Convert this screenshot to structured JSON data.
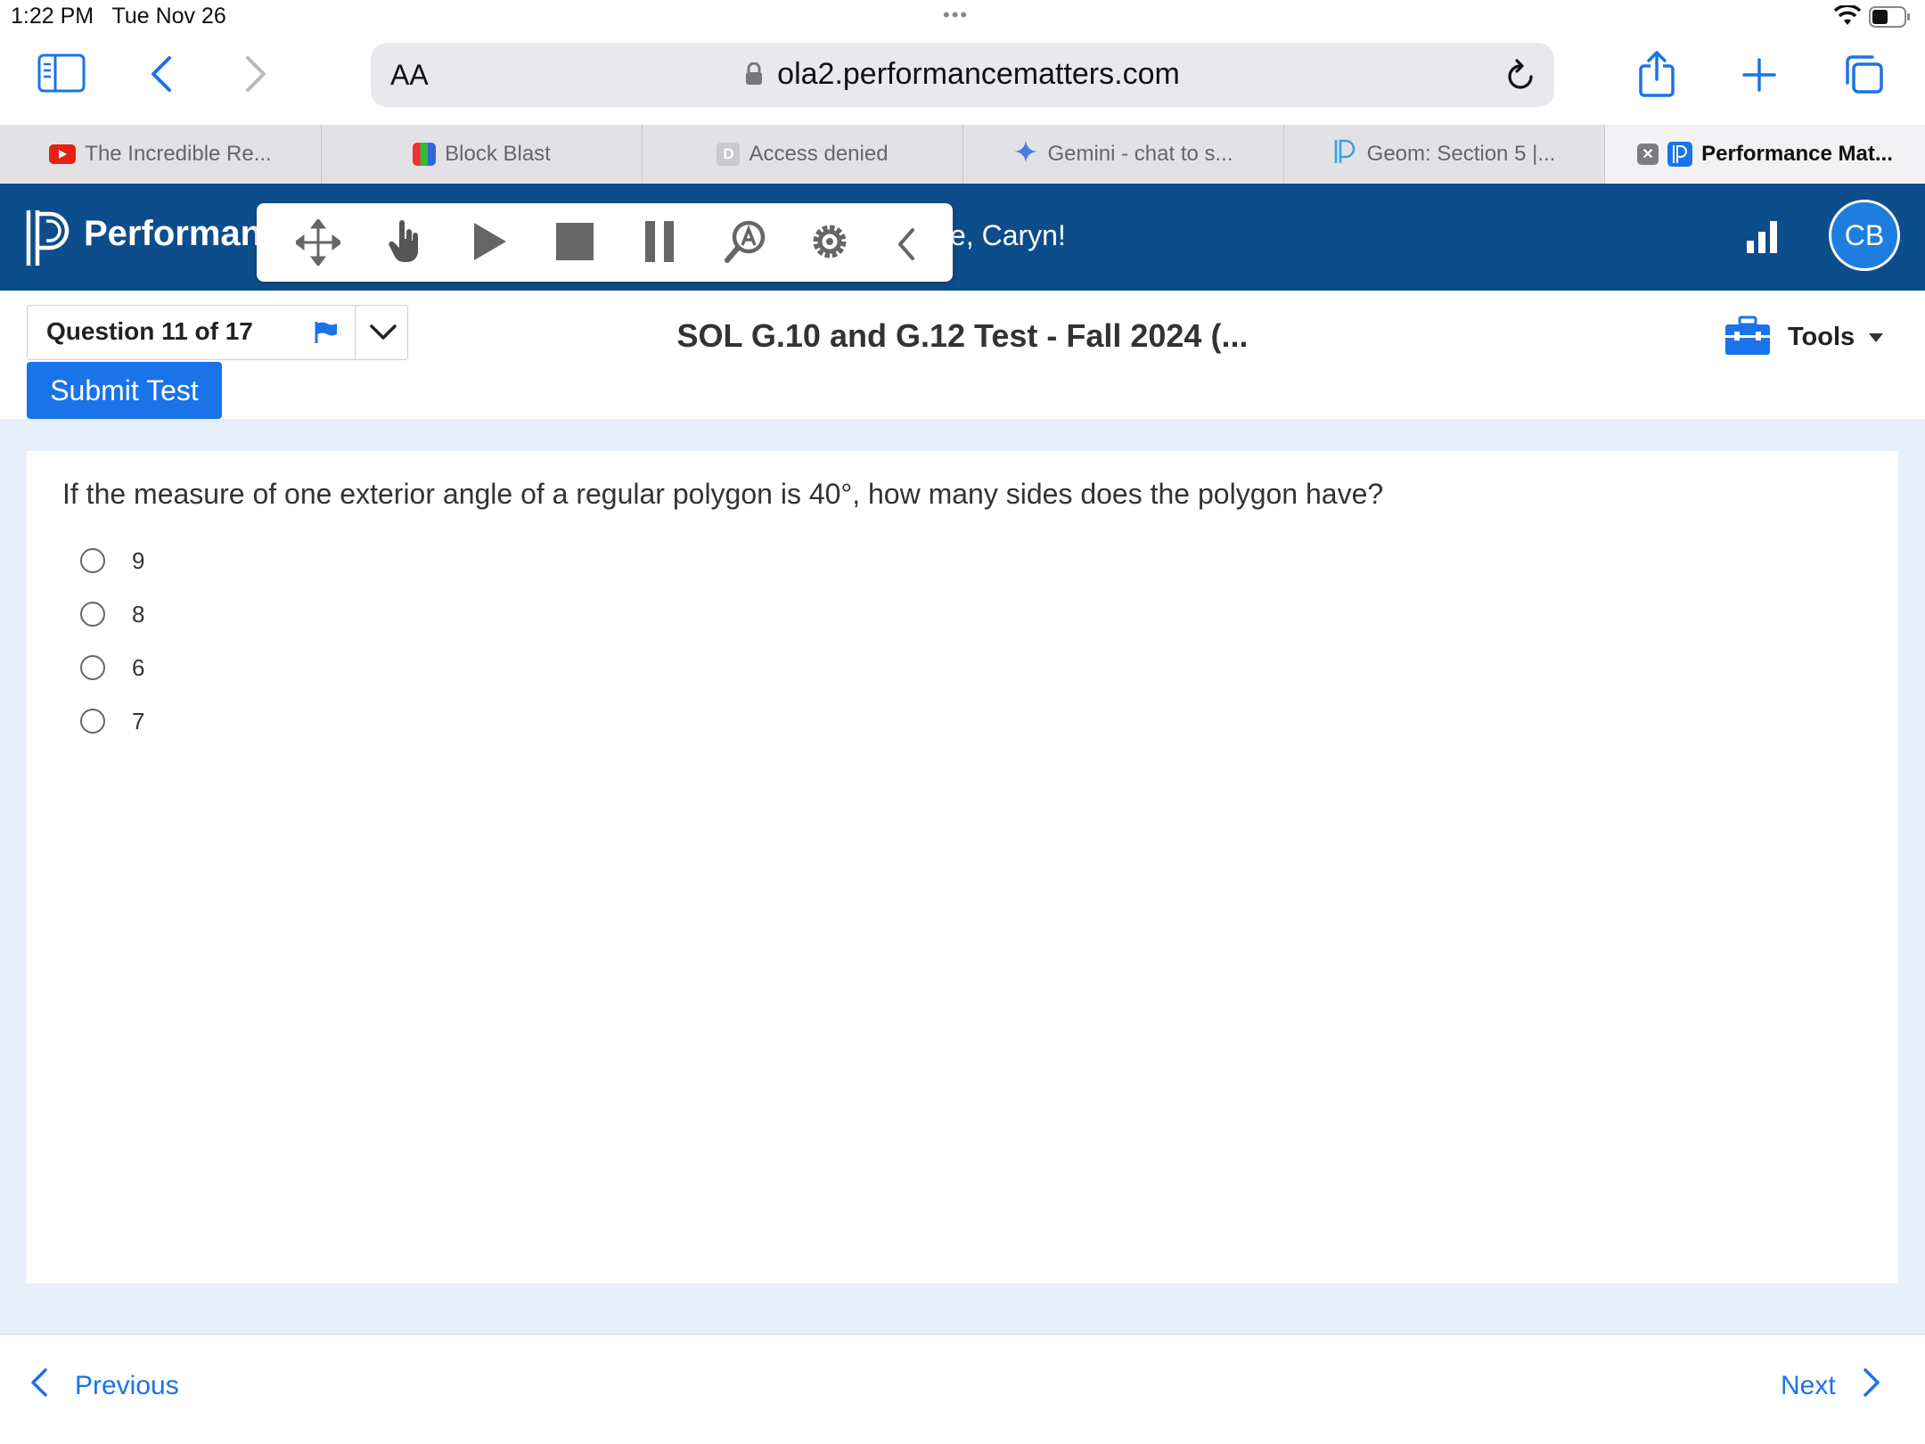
{
  "status": {
    "time": "1:22 PM   Tue Nov 26",
    "dots": "•••"
  },
  "browser": {
    "aa_label": "AA",
    "url": "ola2.performancematters.com",
    "tabs": [
      {
        "label": "The Incredible Re...",
        "icon": "youtube-icon"
      },
      {
        "label": "Block Blast",
        "icon": "block-blast-icon"
      },
      {
        "label": "Access denied",
        "icon": "d-letter-icon",
        "icon_text": "D"
      },
      {
        "label": "Gemini - chat to s...",
        "icon": "gemini-sparkle-icon"
      },
      {
        "label": "Geom: Section 5 |...",
        "icon": "performance-matters-icon"
      },
      {
        "label": "Performance Mat...",
        "icon": "performance-matters-icon",
        "close": "✕",
        "active": true
      }
    ],
    "accent": "#1a73e8"
  },
  "app": {
    "brand": "Performan",
    "greeting": "e, Caryn!",
    "avatar_initials": "CB",
    "header_color": "#0e4d8c"
  },
  "toolbar": {
    "icons": [
      "move-icon",
      "hand-pointer-icon",
      "play-icon",
      "stop-icon",
      "pause-icon",
      "magnifier-a-icon",
      "gear-icon",
      "chevron-left-icon"
    ]
  },
  "test": {
    "question_position": "Question 11 of 17",
    "title": "SOL G.10 and G.12 Test - Fall 2024 (...",
    "submit_label": "Submit Test",
    "tools_label": "Tools"
  },
  "question": {
    "text": "If the measure of one exterior angle of a regular polygon is 40°, how many sides does the polygon have?",
    "options": [
      "9",
      "8",
      "6",
      "7"
    ]
  },
  "nav": {
    "previous": "Previous",
    "next": "Next"
  }
}
